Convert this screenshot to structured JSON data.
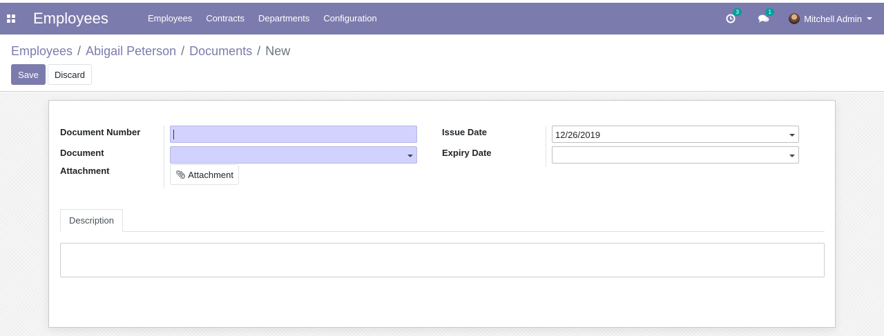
{
  "navbar": {
    "apps_icon": "grid-icon",
    "brand": "Employees",
    "menu": [
      {
        "label": "Employees"
      },
      {
        "label": "Contracts"
      },
      {
        "label": "Departments"
      },
      {
        "label": "Configuration"
      }
    ],
    "activity_badge": "3",
    "messages_badge": "1",
    "user_name": "Mitchell Admin",
    "color": "#7c7bad"
  },
  "breadcrumb": {
    "items": [
      "Employees",
      "Abigail Peterson",
      "Documents"
    ],
    "separator": "/",
    "current": "New"
  },
  "buttons": {
    "save": "Save",
    "discard": "Discard"
  },
  "form": {
    "document_number": {
      "label": "Document Number",
      "value": ""
    },
    "document": {
      "label": "Document",
      "value": ""
    },
    "attachment": {
      "label": "Attachment",
      "button": "Attachment",
      "icon": "paperclip-icon"
    },
    "issue_date": {
      "label": "Issue Date",
      "value": "12/26/2019"
    },
    "expiry_date": {
      "label": "Expiry Date",
      "value": ""
    }
  },
  "tabs": [
    {
      "label": "Description",
      "active": true
    }
  ],
  "description": {
    "value": ""
  },
  "colors": {
    "primary": "#7c7bad",
    "required_field": "#d2d2ff",
    "badge": "#00a09d"
  }
}
